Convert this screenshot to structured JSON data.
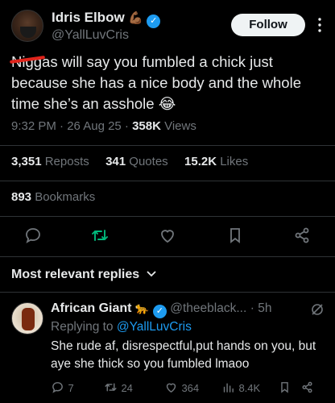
{
  "author": {
    "name": "Idris Elbow",
    "emoji": "💪🏾",
    "handle": "@YallLuvCris",
    "follow_label": "Follow"
  },
  "tweet": {
    "text": "Niggas will say you fumbled a chick just because she has a nice body and the whole time she’s an asshole 😂",
    "time": "9:32 PM · 26 Aug 25 · ",
    "views_count": "358K",
    "views_label": " Views"
  },
  "stats": {
    "reposts_count": "3,351",
    "reposts_label": "Reposts",
    "quotes_count": "341",
    "quotes_label": "Quotes",
    "likes_count": "15.2K",
    "likes_label": "Likes",
    "bookmarks_count": "893",
    "bookmarks_label": "Bookmarks"
  },
  "replies_header": {
    "label": "Most relevant replies"
  },
  "reply": {
    "name": "African Giant",
    "emoji": "🐆",
    "handle": "@theeblack...",
    "time": "· 5h",
    "replying_prefix": "Replying to ",
    "replying_to": "@YallLuvCris",
    "text": "She rude af, disrespectful,put hands on you, but aye she thick so you fumbled lmaoo",
    "replies": "7",
    "reposts": "24",
    "likes": "364",
    "views": "8.4K"
  },
  "colors": {
    "accent": "#1d9bf0",
    "repost_green": "#00ba7c",
    "muted": "#71767b",
    "divider": "#2f3336"
  }
}
